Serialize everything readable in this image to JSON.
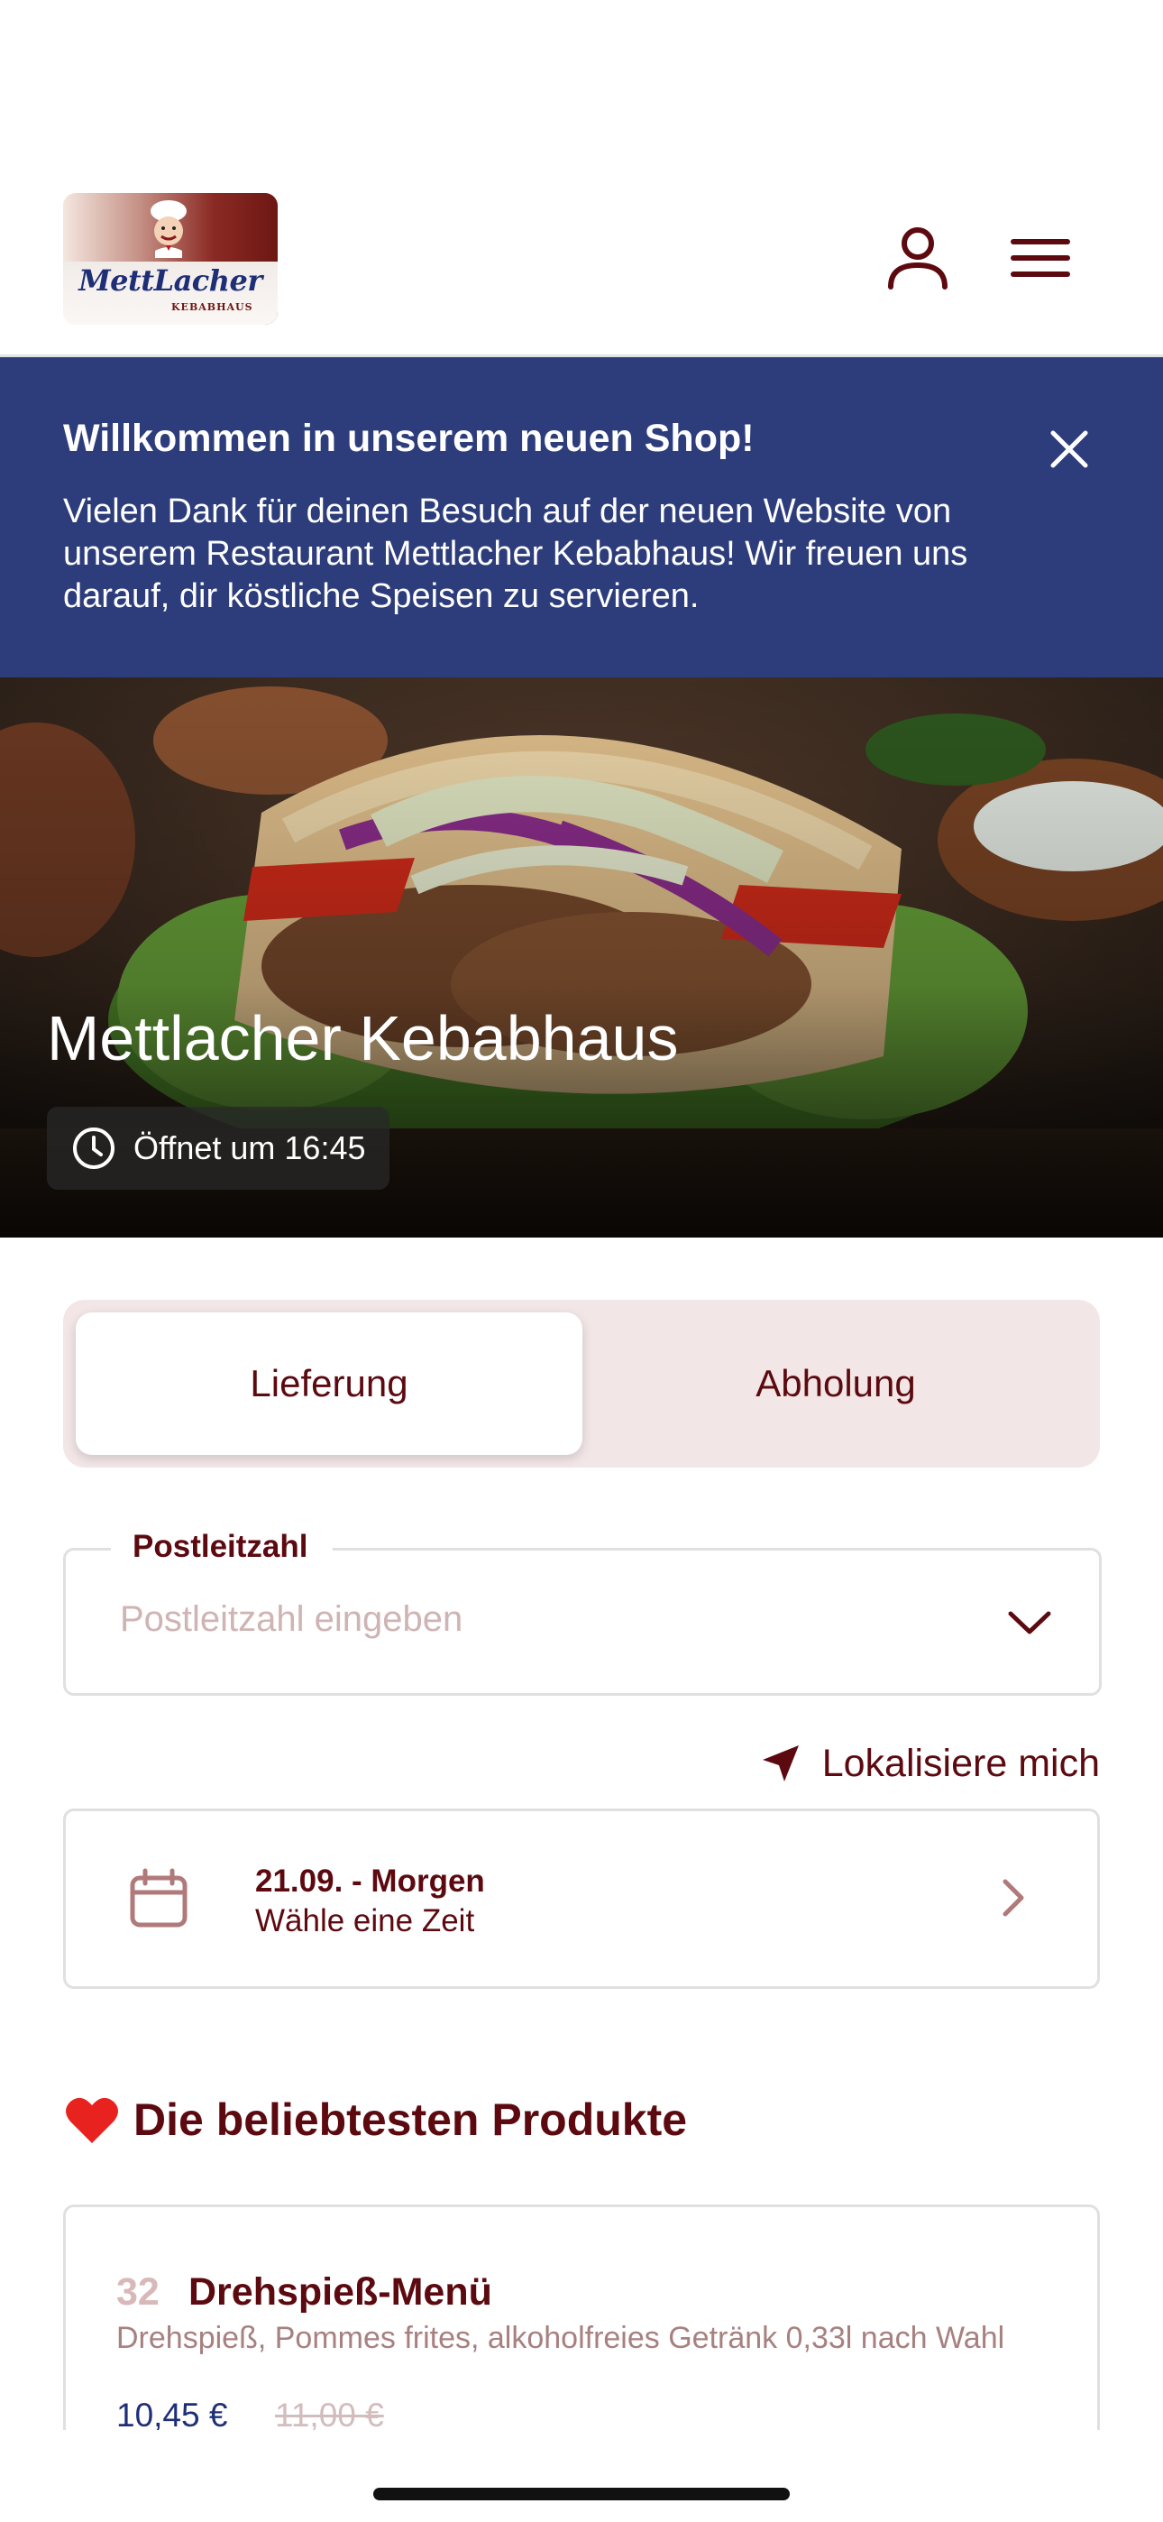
{
  "header": {
    "logo_text": "MettLacher",
    "logo_subtext": "KEBABHAUS",
    "account_icon": "person-icon",
    "menu_icon": "hamburger-menu-icon"
  },
  "banner": {
    "title": "Willkommen in unserem neuen Shop!",
    "text": "Vielen Dank für deinen Besuch auf der neuen Website von unserem Restaurant Mettlacher Kebabhaus! Wir freuen uns darauf, dir köstliche Speisen zu servieren.",
    "close_icon": "close-icon",
    "background": "#2d3d7c"
  },
  "hero": {
    "title": "Mettlacher Kebabhaus",
    "status": "Öffnet um 16:45",
    "clock_icon": "clock-icon"
  },
  "tabs": [
    {
      "label": "Lieferung",
      "active": true
    },
    {
      "label": "Abholung",
      "active": false
    }
  ],
  "postcode": {
    "label": "Postleitzahl",
    "placeholder": "Postleitzahl eingeben",
    "value": ""
  },
  "locate": {
    "label": "Lokalisiere mich",
    "icon": "location-arrow-icon"
  },
  "delivery_time": {
    "date": "21.09. - Morgen",
    "hint": "Wähle eine Zeit"
  },
  "popular": {
    "heading": "Die beliebtesten Produkte",
    "heart_icon": "heart-icon",
    "products": [
      {
        "number": "32",
        "name": "Drehspieß-Menü",
        "description": "Drehspieß, Pommes frites, alkoholfreies Getränk 0,33l nach Wahl",
        "price": "10,45 €",
        "old_price": "11,00 €"
      }
    ]
  },
  "colors": {
    "brand_dark_red": "#5c0a10",
    "brand_blue": "#2d3d7c",
    "tab_background": "#f2e6e6"
  }
}
